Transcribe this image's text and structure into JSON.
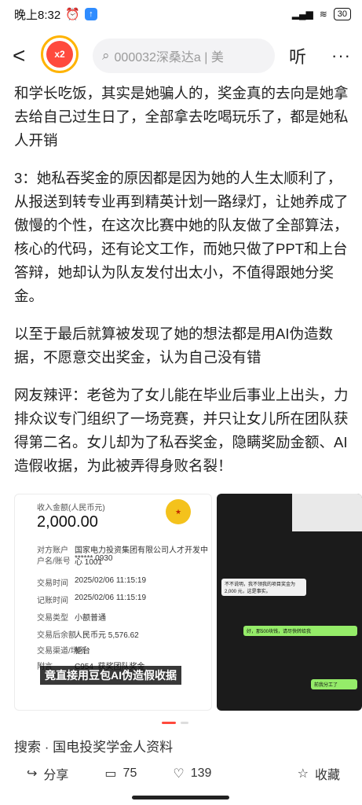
{
  "status_bar": {
    "time": "晚上8:32",
    "battery": "30"
  },
  "header": {
    "search_placeholder": "000032深桑达a | 美",
    "listen_label": "听",
    "more_label": "···",
    "back_label": "<",
    "avatar_text": "x2"
  },
  "article": {
    "paragraphs": [
      "和学长吃饭，其实是她骗人的，奖金真的去向是她拿去给自己过生日了，全部拿去吃喝玩乐了，都是她私人开销",
      "3：她私吞奖金的原因都是因为她的人生太顺利了，从报送到转专业再到精英计划一路绿灯，让她养成了傲慢的个性，在这次比赛中她的队友做了全部算法，核心的代码，还有论文工作，而她只做了PPT和上台答辩，她却认为队友发付出太小，不值得跟她分奖金。",
      "以至于最后就算被发现了她的想法都是用AI伪造数据，不愿意交出奖金，认为自己没有错",
      "网友辣评：老爸为了女儿能在毕业后事业上出头，力排众议专门组织了一场竞赛，并只让女儿所在团队获得第二名。女儿却为了私吞奖金，隐瞒奖励金额、AI造假收据，为此被弄得身败名裂！"
    ]
  },
  "receipt": {
    "amount_label": "收入金额(人民币元)",
    "amount": "2,000.00",
    "rows": [
      {
        "label": "对方账户",
        "value": "国家电力投资集团有限公司人才开发中心 1001"
      },
      {
        "label": "户名/账号",
        "value": "****** 0930"
      },
      {
        "label": "交易时间",
        "value": "2025/02/06 11:15:19"
      },
      {
        "label": "记账时间",
        "value": "2025/02/06 11:15:19"
      },
      {
        "label": "交易类型",
        "value": "小额普通"
      },
      {
        "label": "交易后余额",
        "value": "人民币元 5,576.62"
      },
      {
        "label": "交易渠道/场所",
        "value": "柜台"
      },
      {
        "label": "附言",
        "value": "C954_获奖团队奖金"
      }
    ],
    "caption": "竟直接用豆包AI伪造假收据"
  },
  "chat": {
    "msg1": "不不说明，我不领我的项目奖金为 2,000 元，这是事实。",
    "msg2": "好，那500块钱，请尽快转给我",
    "msg3": "前我分工了"
  },
  "related": "搜索 · 国电投奖学金人资料",
  "bottom_bar": {
    "share": "分享",
    "comments": "75",
    "likes": "139",
    "favorite": "收藏"
  }
}
